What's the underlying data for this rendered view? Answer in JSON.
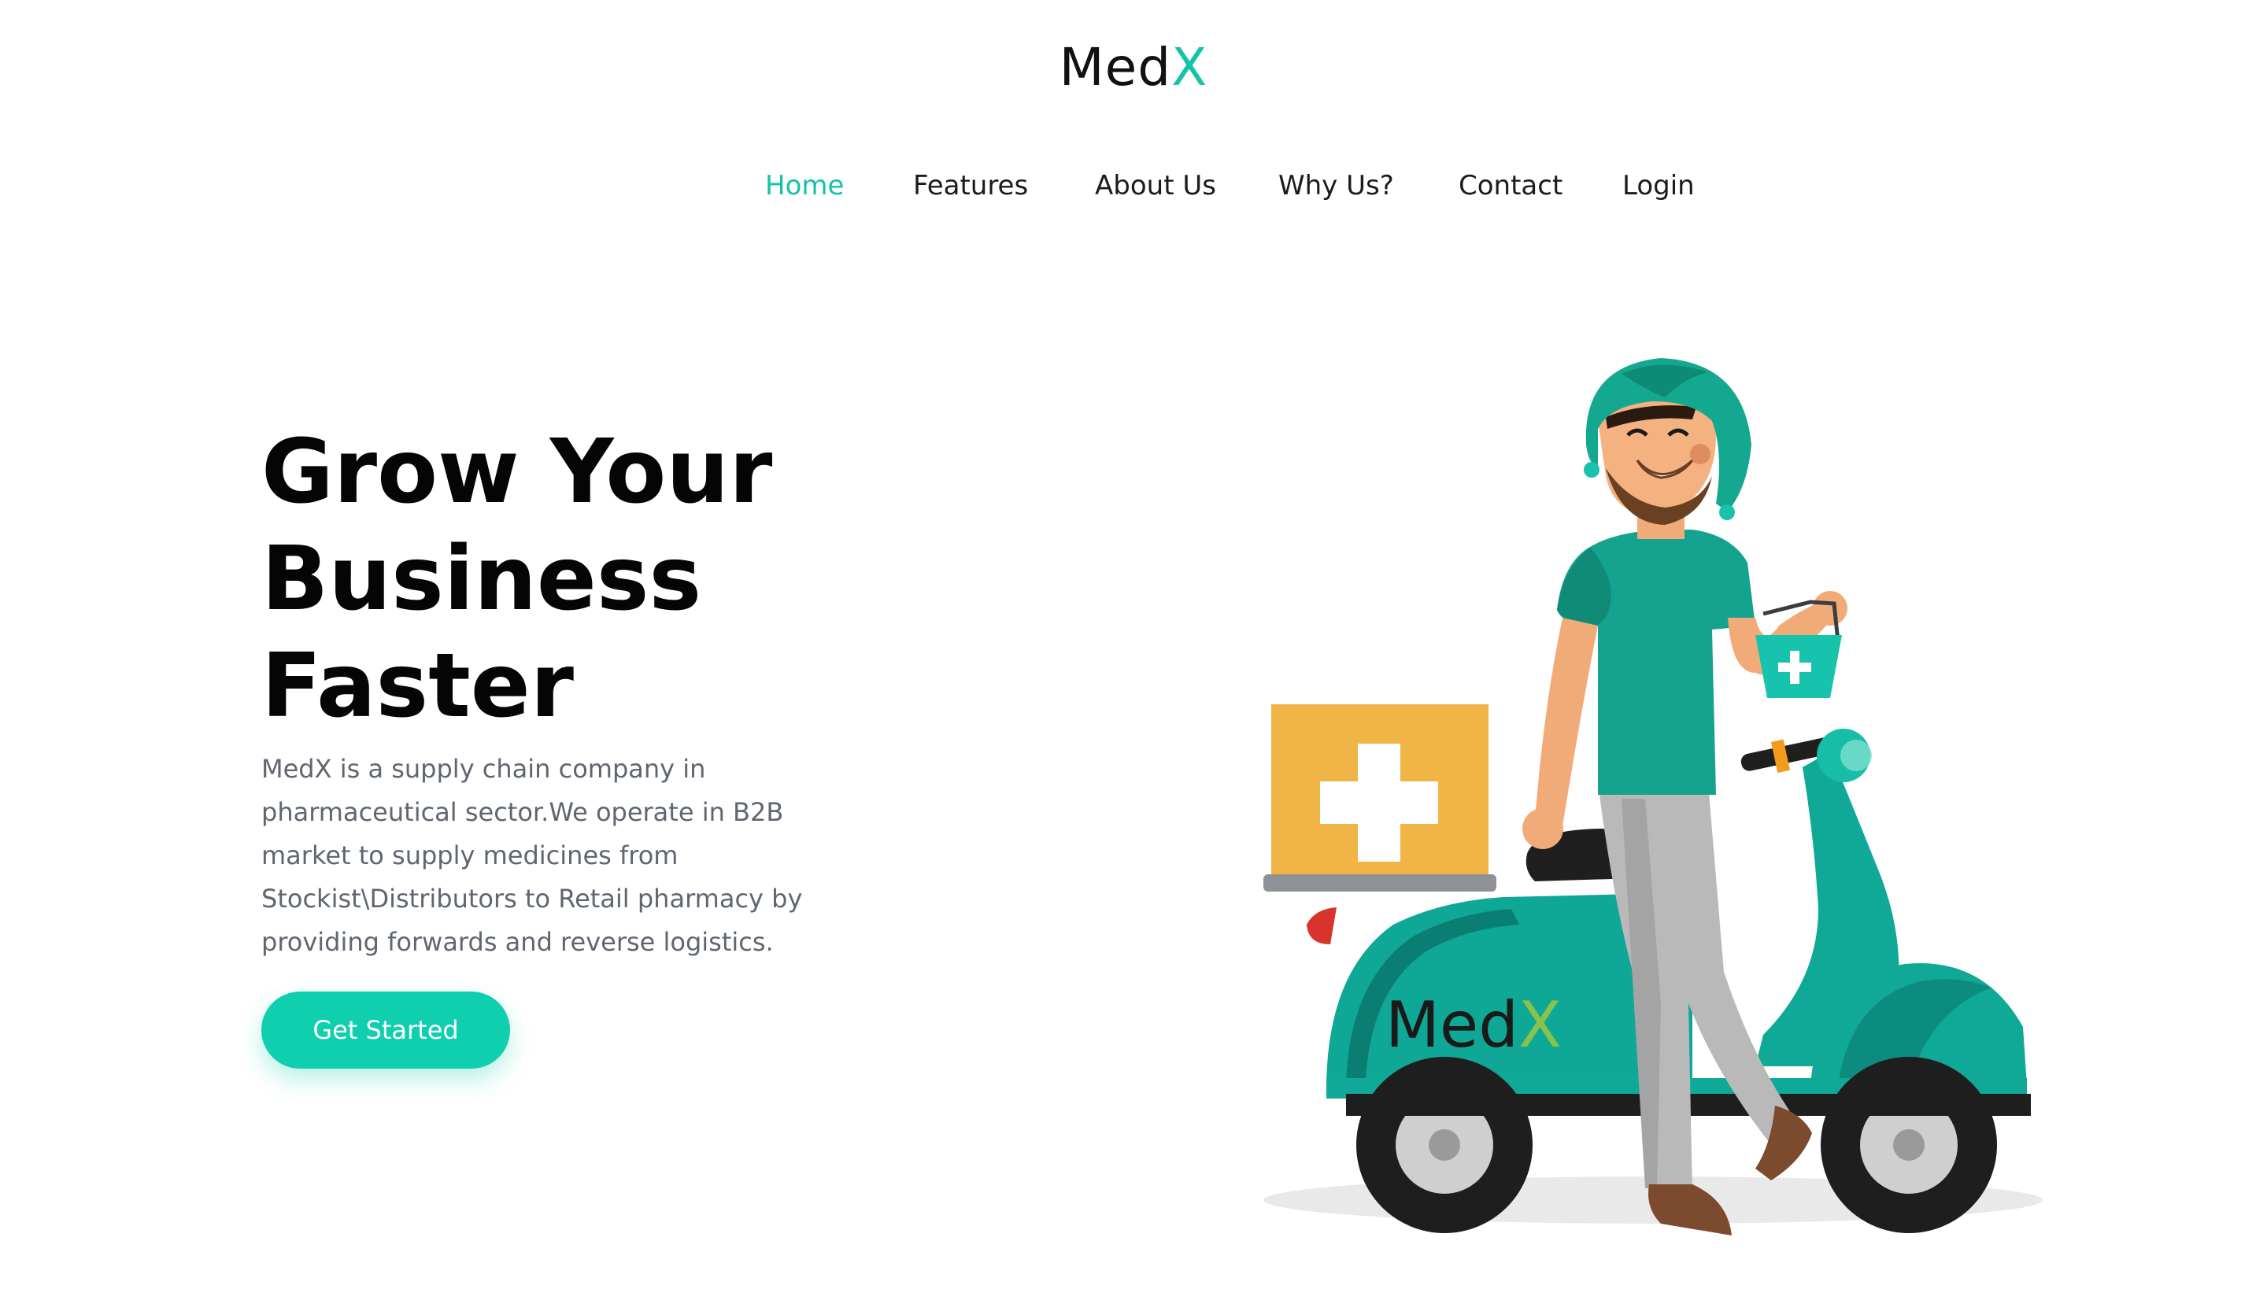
{
  "brand": {
    "prefix": "Med",
    "suffix": "X",
    "accent_color": "#12c4a9"
  },
  "nav": {
    "items": [
      {
        "label": "Home",
        "active": true
      },
      {
        "label": "Features",
        "active": false
      },
      {
        "label": "About Us",
        "active": false
      },
      {
        "label": "Why Us?",
        "active": false
      },
      {
        "label": "Contact",
        "active": false
      },
      {
        "label": "Login",
        "active": false
      }
    ]
  },
  "hero": {
    "title_lines": [
      "Grow Your",
      "Business",
      "Faster"
    ],
    "description": "MedX is a supply chain company in pharmaceutical sector.We operate in B2B market to supply medicines from Stockist\\Distributors to Retail pharmacy by providing forwards and reverse logistics.",
    "cta_label": "Get Started",
    "cta_color": "#10cfaf"
  },
  "illustration": {
    "scooter_logo_prefix": "Med",
    "scooter_logo_suffix": "X",
    "icons": [
      "delivery-person-illustration",
      "scooter-illustration",
      "medicine-box-icon",
      "medicine-bag-icon"
    ]
  }
}
